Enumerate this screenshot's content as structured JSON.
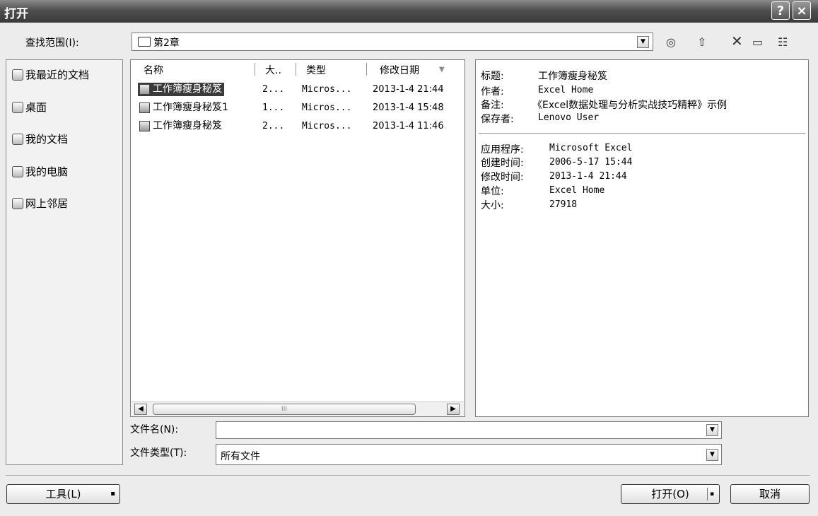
{
  "window": {
    "title": "打开",
    "help": "?",
    "close": "×"
  },
  "lookin": {
    "label": "查找范围(I):",
    "value": "第2章"
  },
  "places": [
    "我最近的文档",
    "桌面",
    "我的文档",
    "我的电脑",
    "网上邻居"
  ],
  "columns": {
    "name": "名称",
    "size": "大..",
    "type": "类型",
    "modified": "修改日期"
  },
  "files": [
    {
      "name": "工作簿瘦身秘笈",
      "size": "2...",
      "type": "Micros...",
      "modified": "2013-1-4 21:44"
    },
    {
      "name": "工作簿瘦身秘笈1",
      "size": "1...",
      "type": "Micros...",
      "modified": "2013-1-4 15:48"
    },
    {
      "name": "工作簿瘦身秘笈",
      "size": "2...",
      "type": "Micros...",
      "modified": "2013-1-4 11:46"
    }
  ],
  "props": [
    {
      "k": "标题:",
      "v": "工作簿瘦身秘笈"
    },
    {
      "k": "作者:",
      "v": "Excel Home"
    },
    {
      "k": "备注:",
      "v": "《Excel数据处理与分析实战技巧精粹》示例"
    },
    {
      "k": "保存者:",
      "v": "Lenovo User"
    }
  ],
  "props2": [
    {
      "k": "应用程序:",
      "v": "Microsoft Excel"
    },
    {
      "k": "创建时间:",
      "v": "2006-5-17 15:44"
    },
    {
      "k": "修改时间:",
      "v": "2013-1-4 21:44"
    },
    {
      "k": "单位:",
      "v": "Excel Home"
    },
    {
      "k": "大小:",
      "v": "27918"
    }
  ],
  "filename": {
    "label": "文件名(N):",
    "value": ""
  },
  "filetype": {
    "label": "文件类型(T):",
    "value": "所有文件"
  },
  "scroll_mark": "III",
  "buttons": {
    "tools": "工具(L)",
    "open": "打开(O)",
    "cancel": "取消"
  },
  "icons": {
    "down": "▼",
    "left": "◀",
    "right": "▶",
    "dot": "▪",
    "back": "◎",
    "up": "⇧",
    "delete": "✕",
    "newfolder": "▭",
    "views": "☷"
  }
}
